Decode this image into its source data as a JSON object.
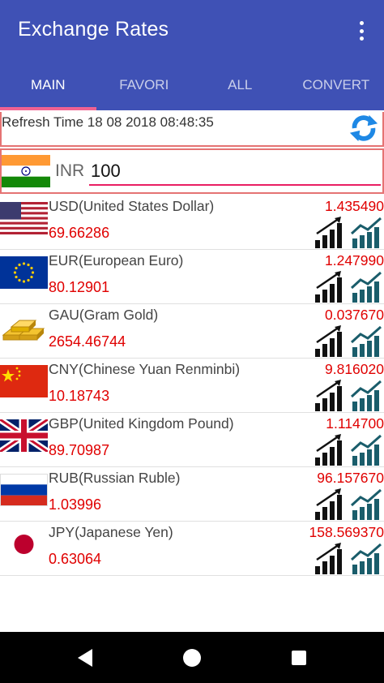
{
  "app": {
    "title": "Exchange Rates"
  },
  "tabs": [
    {
      "label": "MAIN"
    },
    {
      "label": "FAVORI"
    },
    {
      "label": "ALL"
    },
    {
      "label": "CONVERT"
    }
  ],
  "refresh": {
    "text": "Refresh Time 18 08 2018 08:48:35"
  },
  "input": {
    "currency": "INR",
    "amount": "100"
  },
  "rates": [
    {
      "name": "USD(United States Dollar)",
      "rate": "1.435490",
      "inverse": "69.66286",
      "flag": "us-flag"
    },
    {
      "name": "EUR(European Euro)",
      "rate": "1.247990",
      "inverse": "80.12901",
      "flag": "eu-flag"
    },
    {
      "name": "GAU(Gram Gold)",
      "rate": "0.037670",
      "inverse": "2654.46744",
      "flag": "gold-bars"
    },
    {
      "name": "CNY(Chinese Yuan Renminbi)",
      "rate": "9.816020",
      "inverse": "10.18743",
      "flag": "cn-flag"
    },
    {
      "name": "GBP(United Kingdom Pound)",
      "rate": "1.114700",
      "inverse": "89.70987",
      "flag": "gb-flag"
    },
    {
      "name": "RUB(Russian Ruble)",
      "rate": "96.157670",
      "inverse": "1.03996",
      "flag": "ru-flag"
    },
    {
      "name": "JPY(Japanese Yen)",
      "rate": "158.569370",
      "inverse": "0.63064",
      "flag": "jp-flag"
    }
  ],
  "colors": {
    "primary": "#3f51b5",
    "indicator": "#f06292",
    "rate_red": "#e00000",
    "trend_teal": "#1a5d6b"
  }
}
